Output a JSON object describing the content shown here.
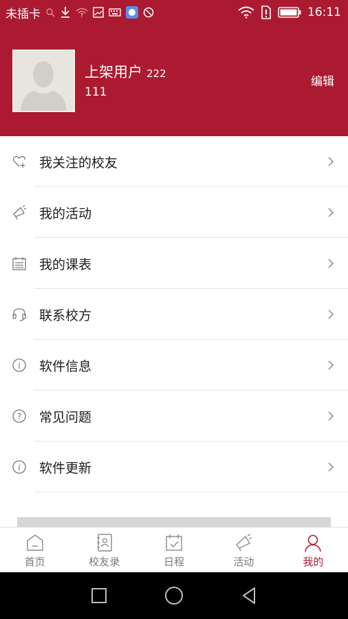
{
  "status_bar": {
    "carrier": "未插卡",
    "time": "16:11",
    "icons": [
      "search-icon",
      "download-icon",
      "wifi-question-icon",
      "image-icon",
      "keyboard-icon",
      "app-badge-icon",
      "sync-icon",
      "wifi-icon",
      "sim-alert-icon",
      "battery-icon"
    ]
  },
  "profile": {
    "name": "上架用户",
    "id": "222",
    "subtitle": "111",
    "edit_label": "编辑"
  },
  "menu": {
    "items": [
      {
        "label": "我关注的校友",
        "icon": "heart-plus-icon"
      },
      {
        "label": "我的活动",
        "icon": "megaphone-icon"
      },
      {
        "label": "我的课表",
        "icon": "calendar-list-icon"
      },
      {
        "label": "联系校方",
        "icon": "headset-icon"
      },
      {
        "label": "软件信息",
        "icon": "info-icon"
      },
      {
        "label": "常见问题",
        "icon": "question-icon"
      },
      {
        "label": "软件更新",
        "icon": "info-icon"
      }
    ]
  },
  "tabs": [
    {
      "label": "首页",
      "icon": "home-icon",
      "active": false
    },
    {
      "label": "校友录",
      "icon": "contacts-book-icon",
      "active": false
    },
    {
      "label": "日程",
      "icon": "calendar-check-icon",
      "active": false
    },
    {
      "label": "活动",
      "icon": "megaphone-icon",
      "active": false
    },
    {
      "label": "我的",
      "icon": "person-icon",
      "active": true
    }
  ],
  "colors": {
    "brand": "#ac1a31",
    "tab_inactive": "#7a7a7a",
    "divider": "#e4e4e4"
  }
}
